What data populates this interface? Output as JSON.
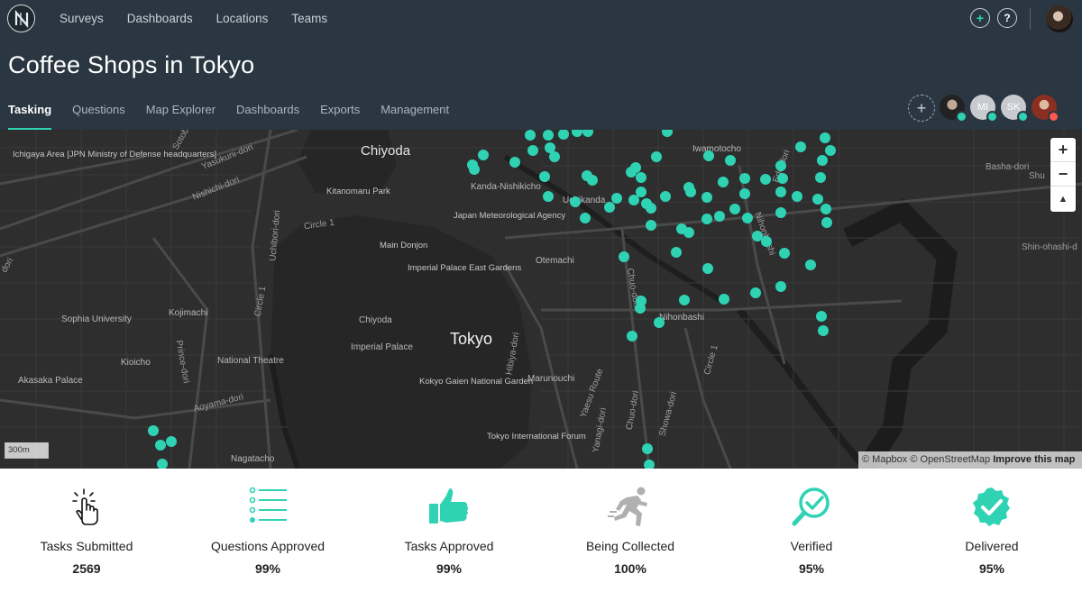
{
  "app": {
    "nav": [
      "Surveys",
      "Dashboards",
      "Locations",
      "Teams"
    ],
    "title": "Coffee Shops in Tokyo",
    "tabs": [
      "Tasking",
      "Questions",
      "Map Explorer",
      "Dashboards",
      "Exports",
      "Management"
    ],
    "active_tab": "Tasking",
    "members": [
      "MI",
      "SK"
    ]
  },
  "map": {
    "labels": {
      "chiyoda": "Chiyoda",
      "tokyo": "Tokyo",
      "ichigaya": "Ichigaya Area [JPN Ministry of Defense headquarters]",
      "kitanomaru": "Kitanomaru Park",
      "jma": "Japan Meteorological Agency",
      "main_donjon": "Main Donjon",
      "ipeg": "Imperial Palace East Gardens",
      "otemachi": "Otemachi",
      "kanda": "Kanda-Nishikicho",
      "uchikanda": "Uchikanda",
      "iwamotocho": "Iwamotocho",
      "sophia": "Sophia University",
      "kojimachi": "Kojimachi",
      "chiyoda_small": "Chiyoda",
      "imperial_palace": "Imperial Palace",
      "nihonbashi": "Nihonbashi",
      "kioicho": "Kioicho",
      "national_theatre": "National Theatre",
      "akasaka": "Akasaka Palace",
      "kokyo": "Kokyo Gaien National Garden",
      "marunouchi": "Marunouchi",
      "tif": "Tokyo International Forum",
      "nagatacho": "Nagatacho",
      "yasukuni": "Yasukuni-dori",
      "nishichi": "Nishichi-dori",
      "circle1a": "Circle 1",
      "circle1b": "Circle 1",
      "circle1c": "Circle 1",
      "uchibori": "Uchibori-dori",
      "prince": "Prince-dori",
      "aoyama": "Aoyama-dori",
      "hibiya": "Hibiya-dori",
      "yaesu": "Yaesu Route",
      "yanagi": "Yanagi-dori",
      "chuo": "Chuo-dori",
      "showa": "Showa-dori",
      "edo": "Edo-dori",
      "nihonbashi_road": "Nihonbashi",
      "chuodori2": "Chuo-dori",
      "basha": "Basha-dori",
      "shin_ohashi": "Shin-ohashi-d",
      "shu": "Shu",
      "dori": "dori",
      "sotobori": "Sotobori"
    },
    "scale": "300m",
    "attribution": "© Mapbox © OpenStreetMap",
    "attribution_link": "Improve this map",
    "dot_color": "#2fd3b4"
  },
  "stats": [
    {
      "label": "Tasks Submitted",
      "value": "2569",
      "icon": "tap-hand-icon"
    },
    {
      "label": "Questions Approved",
      "value": "99%",
      "icon": "checklist-icon"
    },
    {
      "label": "Tasks Approved",
      "value": "99%",
      "icon": "thumbs-up-icon"
    },
    {
      "label": "Being Collected",
      "value": "100%",
      "icon": "running-person-icon"
    },
    {
      "label": "Verified",
      "value": "95%",
      "icon": "magnifier-check-icon"
    },
    {
      "label": "Delivered",
      "value": "95%",
      "icon": "check-badge-icon"
    }
  ]
}
